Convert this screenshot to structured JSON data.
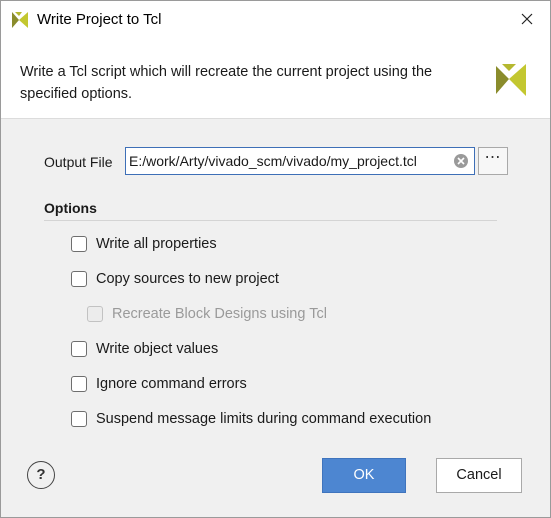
{
  "window": {
    "title": "Write Project to Tcl",
    "icon": "vivado-logo-icon",
    "close_icon": "close-icon"
  },
  "header": {
    "description": "Write a Tcl script which will recreate the current project using the specified options.",
    "logo": "vivado-logo-icon"
  },
  "output_file": {
    "label": "Output File",
    "value": "E:/work/Arty/vivado_scm/vivado/my_project.tcl",
    "clear_icon": "clear-icon",
    "browse_label": "⋯"
  },
  "options": {
    "heading": "Options",
    "items": [
      {
        "label": "Write all properties",
        "checked": false,
        "enabled": true
      },
      {
        "label": "Copy sources to new project",
        "checked": false,
        "enabled": true
      },
      {
        "label": "Recreate Block Designs using Tcl",
        "checked": false,
        "enabled": false
      },
      {
        "label": "Write object values",
        "checked": false,
        "enabled": true
      },
      {
        "label": "Ignore command errors",
        "checked": false,
        "enabled": true
      },
      {
        "label": "Suspend message limits during command execution",
        "checked": false,
        "enabled": true
      }
    ]
  },
  "footer": {
    "help_label": "?",
    "ok_label": "OK",
    "cancel_label": "Cancel"
  },
  "colors": {
    "accent": "#4d86d1",
    "logo_dark": "#8a8c2c",
    "logo_light": "#c3c730"
  }
}
